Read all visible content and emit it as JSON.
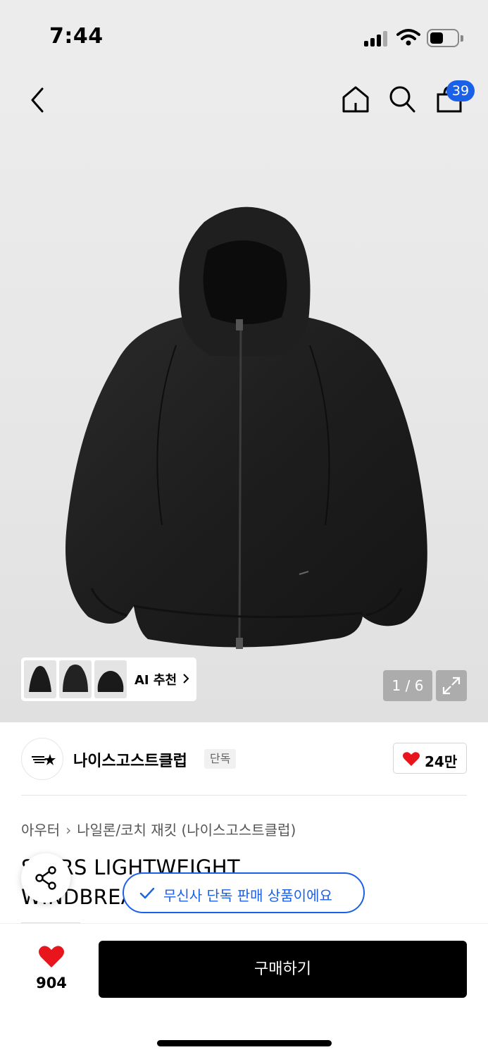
{
  "status_bar": {
    "time": "7:44"
  },
  "nav": {
    "cart_count": "39"
  },
  "gallery": {
    "ai_label": "AI 추천",
    "page_indicator": "1 / 6"
  },
  "brand": {
    "name": "나이스고스트클럽",
    "badge": "단독",
    "likes": "24만"
  },
  "breadcrumb": {
    "category": "아우터",
    "subcategory": "나일론/코치 재킷 (나이스고스트클럽)"
  },
  "product": {
    "title": "STARS LIGHTWEIGHT WINDBREAKER_BLACK(NG..."
  },
  "toast": {
    "text": "무신사 단독 판매 상품이에요"
  },
  "bottom_bar": {
    "wish_count": "904",
    "buy_label": "구매하기"
  },
  "colors": {
    "accent": "#1b61e8",
    "heart": "#e8151c",
    "primary_button": "#000000"
  }
}
